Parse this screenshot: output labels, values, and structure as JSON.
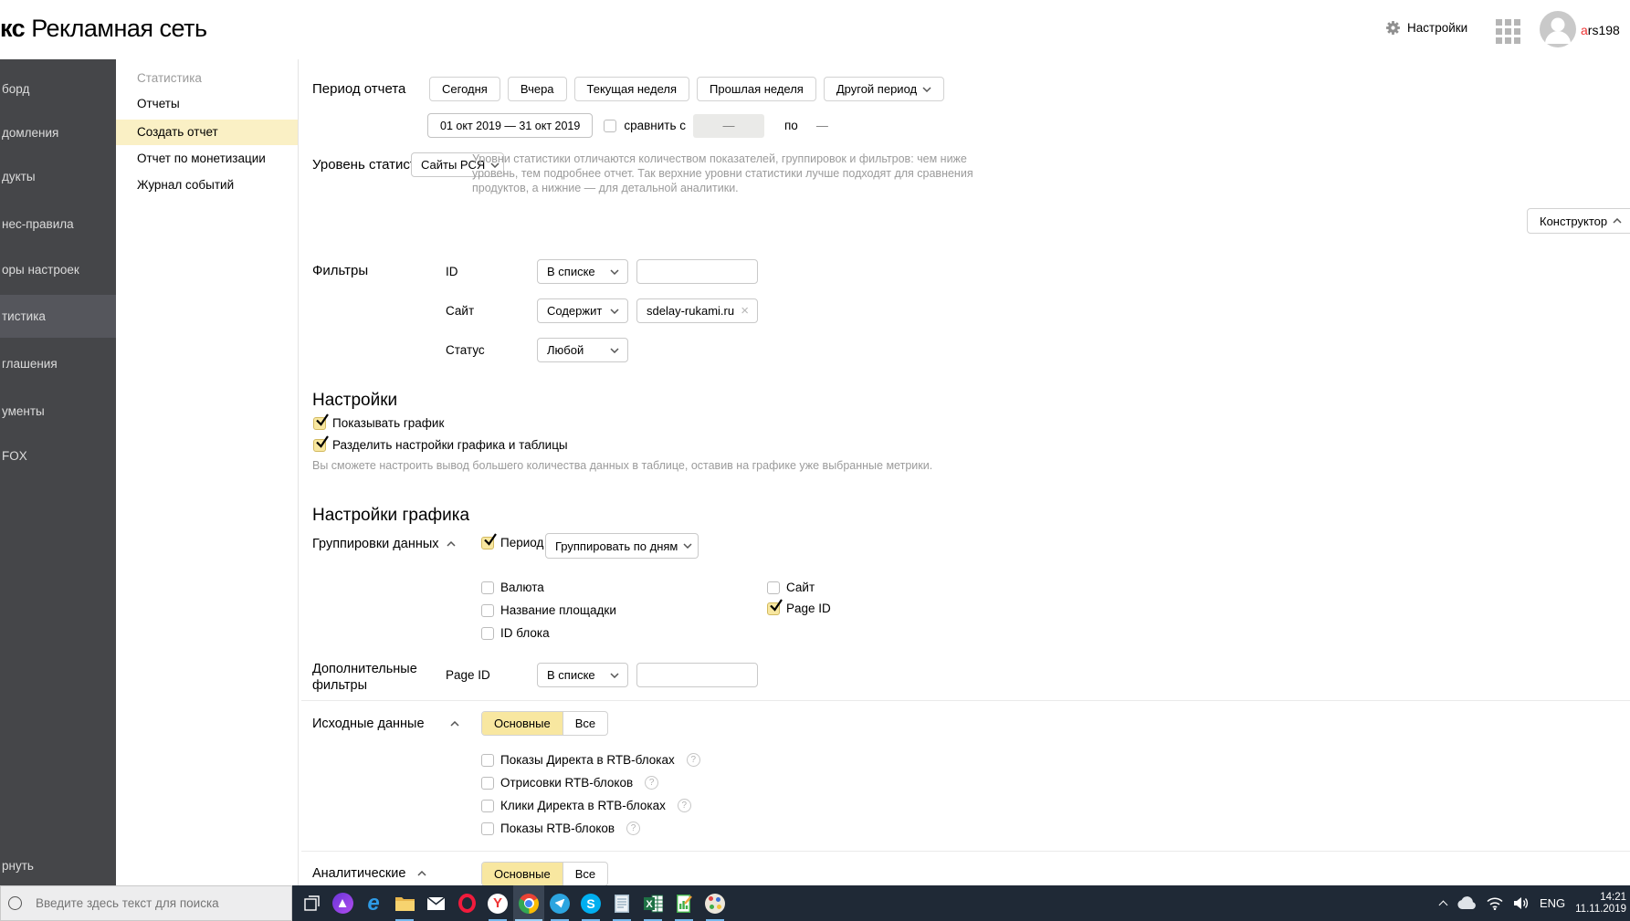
{
  "header": {
    "logo_prefix": "кс",
    "logo_name": "Рекламная сеть",
    "settings_label": "Настройки",
    "username_first": "a",
    "username_rest": "rs198"
  },
  "sidebar": {
    "items": [
      {
        "label": "борд"
      },
      {
        "label": "домления"
      },
      {
        "label": "дукты"
      },
      {
        "label": "нес-правила"
      },
      {
        "label": "оры настроек"
      },
      {
        "label": "тистика",
        "active": true
      },
      {
        "label": "глашения"
      },
      {
        "label": "ументы"
      },
      {
        "label": "FOX"
      }
    ],
    "collapse_label": "рнуть"
  },
  "subnav": {
    "title": "Статистика",
    "items": [
      {
        "label": "Отчеты"
      },
      {
        "label": "Создать отчет",
        "active": true
      },
      {
        "label": "Отчет по монетизации"
      },
      {
        "label": "Журнал событий"
      }
    ]
  },
  "period": {
    "label": "Период отчета",
    "presets": [
      "Сегодня",
      "Вчера",
      "Текущая неделя",
      "Прошлая неделя"
    ],
    "other": "Другой период",
    "range": "01 окт 2019 — 31 окт 2019",
    "compare": "сравнить с",
    "compare_value": "—",
    "to": "по",
    "to_value": "—"
  },
  "stats_level": {
    "label": "Уровень статистики",
    "value": "Сайты РСЯ",
    "help": "Уровни статистики отличаются количеством показателей, группировок и фильтров: чем ниже уровень, тем подробнее отчет. Так верхние уровни статистики лучше подходят для сравнения продуктов, а нижние — для детальной аналитики."
  },
  "constructor": {
    "label": "Конструктор"
  },
  "filters": {
    "label": "Фильтры",
    "rows": [
      {
        "field": "ID",
        "operator": "В списке",
        "value": ""
      },
      {
        "field": "Сайт",
        "operator": "Содержит",
        "value": "sdelay-rukami.ru"
      },
      {
        "field": "Статус",
        "operator": "Любой"
      }
    ]
  },
  "settings": {
    "title": "Настройки",
    "options": [
      {
        "label": "Показывать график",
        "checked": true
      },
      {
        "label": "Разделить настройки графика и таблицы",
        "checked": true
      }
    ],
    "note": "Вы сможете настроить вывод большего количества данных в таблице, оставив на графике уже выбранные метрики."
  },
  "chart_settings": {
    "title": "Настройки графика",
    "groupings_label": "Группировки данных",
    "period_option": {
      "label": "Период",
      "checked": true,
      "value": "Группировать по дням"
    },
    "options_col1": [
      {
        "label": "Валюта",
        "checked": false
      },
      {
        "label": "Название площадки",
        "checked": false
      },
      {
        "label": "ID блока",
        "checked": false
      }
    ],
    "options_col2": [
      {
        "label": "Сайт",
        "checked": false
      },
      {
        "label": "Page ID",
        "checked": true
      }
    ]
  },
  "extra_filters": {
    "label": "Дополнительные фильтры",
    "field": "Page ID",
    "operator": "В списке",
    "value": ""
  },
  "source_data": {
    "label": "Исходные данные",
    "tabs": [
      "Основные",
      "Все"
    ],
    "selected": "Основные",
    "options": [
      {
        "label": "Показы Директа в RTB-блоках",
        "checked": false
      },
      {
        "label": "Отрисовки RTB-блоков",
        "checked": false
      },
      {
        "label": "Клики Директа в RTB-блоках",
        "checked": false
      },
      {
        "label": "Показы RTB-блоков",
        "checked": false
      }
    ]
  },
  "analytics": {
    "label": "Аналитические",
    "tabs": [
      "Основные",
      "Все"
    ],
    "selected": "Основные"
  },
  "taskbar": {
    "search_placeholder": "Введите здесь текст для поиска",
    "icons": [
      {
        "name": "task-view"
      },
      {
        "name": "alice"
      },
      {
        "name": "edge",
        "glyph": "e"
      },
      {
        "name": "explorer"
      },
      {
        "name": "mail"
      },
      {
        "name": "opera"
      },
      {
        "name": "yandex-browser",
        "glyph": "Y"
      },
      {
        "name": "chrome"
      },
      {
        "name": "telegram"
      },
      {
        "name": "skype",
        "glyph": "S"
      },
      {
        "name": "notepad"
      },
      {
        "name": "excel",
        "glyph": "X"
      },
      {
        "name": "report"
      },
      {
        "name": "paint"
      }
    ],
    "tray": {
      "language": "ENG",
      "time": "14:21",
      "date": "11.11.2019"
    }
  }
}
